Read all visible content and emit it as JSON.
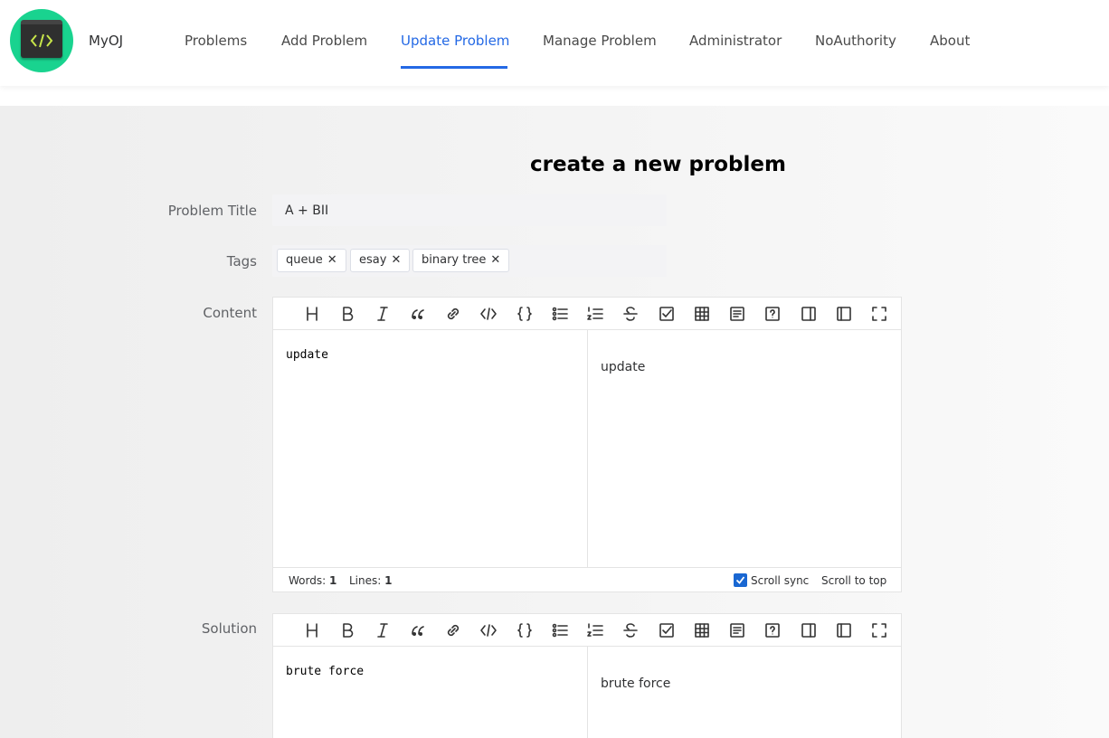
{
  "header": {
    "brand": "MyOJ",
    "nav": [
      {
        "label": "Problems",
        "active": false
      },
      {
        "label": "Add Problem",
        "active": false
      },
      {
        "label": "Update Problem",
        "active": true
      },
      {
        "label": "Manage Problem",
        "active": false
      },
      {
        "label": "Administrator",
        "active": false
      },
      {
        "label": "NoAuthority",
        "active": false
      },
      {
        "label": "About",
        "active": false
      }
    ],
    "logo_icon": "code-icon",
    "accent_color": "#2469e5",
    "logo_color": "#19d38f"
  },
  "form": {
    "page_title": "create a new problem",
    "title_label": "Problem Title",
    "title_value": "A + BII",
    "tags_label": "Tags",
    "tags": [
      {
        "label": "queue",
        "close": "✕"
      },
      {
        "label": "esay",
        "close": "✕"
      },
      {
        "label": "binary tree",
        "close": "✕"
      }
    ],
    "content_label": "Content",
    "solution_label": "Solution"
  },
  "toolbar_icons": [
    "heading-icon",
    "bold-icon",
    "italic-icon",
    "quote-icon",
    "link-icon",
    "code-icon",
    "code-block-icon",
    "unordered-list-icon",
    "ordered-list-icon",
    "strikethrough-icon",
    "task-list-icon",
    "table-icon",
    "toc-icon",
    "help-icon",
    "preview-only-icon",
    "editor-only-icon",
    "fullscreen-icon"
  ],
  "content_editor": {
    "source": "update",
    "preview": "update",
    "footer": {
      "words_label": "Words:",
      "words": "1",
      "lines_label": "Lines:",
      "lines": "1",
      "scroll_sync": "Scroll sync",
      "scroll_sync_checked": true,
      "scroll_top": "Scroll to top"
    }
  },
  "solution_editor": {
    "source": "brute force",
    "preview": "brute force"
  }
}
